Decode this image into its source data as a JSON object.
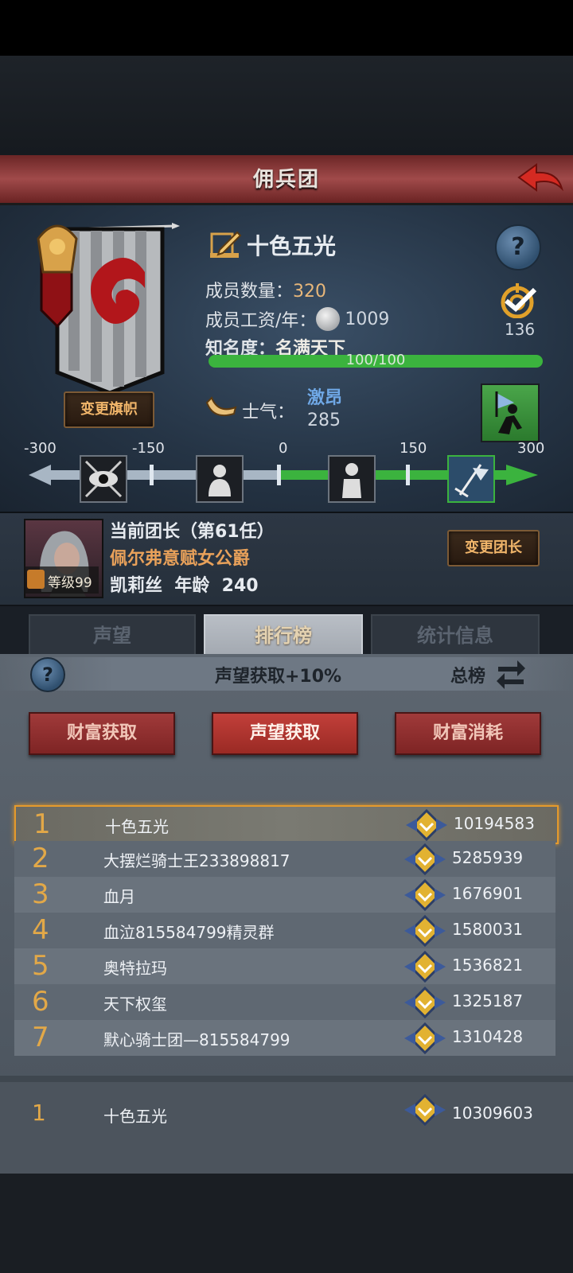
{
  "header": {
    "title": "佣兵团"
  },
  "guild": {
    "name": "十色五光",
    "member_count_label": "成员数量：",
    "member_count": "320",
    "salary_label": "成员工资/年：",
    "salary": "1009",
    "fame_label": "知名度：",
    "fame_value": "名满天下",
    "fame_progress_text": "100/100",
    "fame_progress": 1.0,
    "achievement_count": "136",
    "change_banner_label": "变更旗帜",
    "morale_label": "士气：",
    "morale_state": "激昂",
    "morale_value": "285"
  },
  "morale_scale": {
    "ticks": [
      "-300",
      "-150",
      "0",
      "150",
      "300"
    ],
    "value": 285
  },
  "leader": {
    "title": "当前团长（第61任）",
    "nobility": "佩尔弗意赋女公爵",
    "name_age": "凯莉丝  年龄  240",
    "level": "等级99",
    "change_leader_label": "变更团长"
  },
  "tabs": [
    {
      "label": "声望"
    },
    {
      "label": "排行榜"
    },
    {
      "label": "统计信息"
    }
  ],
  "ranking": {
    "bonus_text": "声望获取+10%",
    "scope_label": "总榜",
    "filters": [
      {
        "label": "财富获取"
      },
      {
        "label": "声望获取"
      },
      {
        "label": "财富消耗"
      }
    ],
    "rows": [
      {
        "rank": "1",
        "name": "十色五光",
        "score": "10194583"
      },
      {
        "rank": "2",
        "name": "大摆烂骑士王233898817",
        "score": "5285939"
      },
      {
        "rank": "3",
        "name": "血月",
        "score": "1676901"
      },
      {
        "rank": "4",
        "name": "血泣815584799精灵群",
        "score": "1580031"
      },
      {
        "rank": "5",
        "name": "奥特拉玛",
        "score": "1536821"
      },
      {
        "rank": "6",
        "name": "天下权玺",
        "score": "1325187"
      },
      {
        "rank": "7",
        "name": "默心骑士团—815584799",
        "score": "1310428"
      }
    ],
    "my_row": {
      "rank": "1",
      "name": "十色五光",
      "score": "10309603"
    }
  },
  "colors": {
    "title_bar": "#a04a4a",
    "accent_gold": "#e8b77a",
    "progress_green": "#3bb33e",
    "rank_highlight": "#e2a848",
    "red_button": "#a03a3a"
  }
}
